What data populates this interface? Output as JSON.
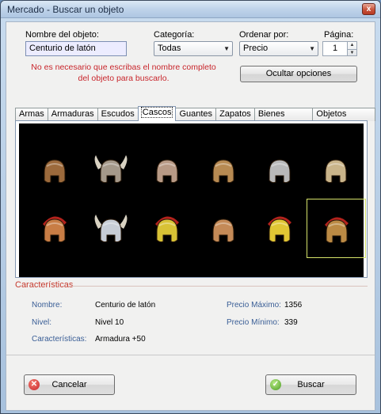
{
  "window": {
    "title": "Mercado - Buscar un objeto",
    "close_glyph": "x"
  },
  "form": {
    "name_label": "Nombre del objeto:",
    "name_value": "Centurio de latón",
    "category_label": "Categoría:",
    "category_value": "Todas",
    "order_label": "Ordenar por:",
    "order_value": "Precio",
    "page_label": "Página:",
    "page_value": "1",
    "hint": "No es necesario que escribas el nombre completo del objeto para buscarlo.",
    "hide_options_label": "Ocultar opciones"
  },
  "tabs": [
    {
      "label": "Armas"
    },
    {
      "label": "Armaduras"
    },
    {
      "label": "Escudos"
    },
    {
      "label": "Cascos",
      "active": true
    },
    {
      "label": "Guantes"
    },
    {
      "label": "Zapatos"
    },
    {
      "label": "Bienes Generales"
    },
    {
      "label": "Objetos Especiales"
    }
  ],
  "items": [
    {
      "icon": "bronze-hood-helmet-icon",
      "color": "#9c6a3c"
    },
    {
      "icon": "viking-steel-helmet-icon",
      "color": "#a5998a"
    },
    {
      "icon": "gladiator-gauntlet-helmet-icon",
      "color": "#b89a86"
    },
    {
      "icon": "bronze-visor-helmet-icon",
      "color": "#b78a52"
    },
    {
      "icon": "silver-nasal-helmet-icon",
      "color": "#b9b9b9"
    },
    {
      "icon": "skull-helmet-icon",
      "color": "#c9b48a"
    },
    {
      "icon": "red-crest-roman-helmet-icon",
      "color": "#c87d45"
    },
    {
      "icon": "horned-steel-helmet-icon",
      "color": "#c7cdd6"
    },
    {
      "icon": "golden-crest-helmet-icon",
      "color": "#d8c235"
    },
    {
      "icon": "bronze-round-helmet-icon",
      "color": "#c48a57"
    },
    {
      "icon": "golden-spartan-helmet-icon",
      "color": "#e0c634"
    },
    {
      "icon": "brass-centurion-helmet-icon",
      "color": "#bb8a44",
      "selected": true
    }
  ],
  "details": {
    "section_title": "Características",
    "name_key": "Nombre:",
    "name_value": "Centurio de latón",
    "level_key": "Nivel:",
    "level_value": "Nivel 10",
    "stats_key": "Características:",
    "stats_value": "Armadura +50",
    "max_price_key": "Precio Máximo:",
    "max_price_value": "1356",
    "min_price_key": "Precio Mínimo:",
    "min_price_value": "339"
  },
  "actions": {
    "cancel_label": "Cancelar",
    "search_label": "Buscar"
  },
  "colors": {
    "accent_red": "#c8252b",
    "key_blue": "#3a5e96",
    "selected_border": "#d6e36a"
  }
}
